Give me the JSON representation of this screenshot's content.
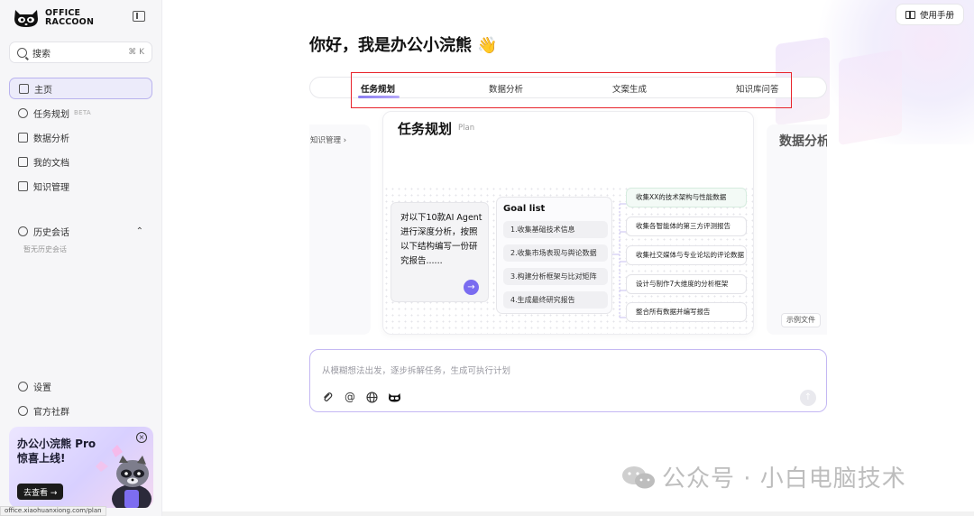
{
  "sidebar": {
    "logo_line1": "OFFICE",
    "logo_line2": "RACCOON",
    "search_label": "搜索",
    "search_shortcut": "⌘ K",
    "nav": [
      {
        "label": "主页",
        "badge": ""
      },
      {
        "label": "任务规划",
        "badge": "BETA"
      },
      {
        "label": "数据分析",
        "badge": ""
      },
      {
        "label": "我的文档",
        "badge": ""
      },
      {
        "label": "知识管理",
        "badge": ""
      }
    ],
    "history_label": "历史会话",
    "history_empty": "暂无历史会话",
    "settings_label": "设置",
    "community_label": "官方社群",
    "promo_title": "办公小浣熊 Pro 惊喜上线!",
    "promo_button": "去查看 →",
    "status_url": "office.xiaohuanxiong.com/plan"
  },
  "header": {
    "manual_label": "使用手册"
  },
  "main": {
    "greeting": "你好，我是办公小浣熊 👋",
    "tabs": [
      "任务规划",
      "数据分析",
      "文案生成",
      "知识库问答"
    ],
    "left_card_label": "知识管理 ›",
    "right_card_title": "数据分析",
    "right_card_button": "示例文件",
    "card": {
      "title": "任务规划",
      "subtitle": "Plan",
      "prompt": "对以下10款AI Agent进行深度分析，按照以下结构编写一份研究报告......",
      "goal_title": "Goal list",
      "goals": [
        "1.收集基础技术信息",
        "2.收集市场表现与舆论数据",
        "3.构建分析框架与比对矩阵",
        "4.生成最终研究报告"
      ],
      "tasks": [
        "收集XX的技术架构与性能数据",
        "收集各智能体的第三方评测报告",
        "收集社交媒体与专业论坛的评论数据",
        "设计与制作7大维度的分析框架",
        "整合所有数据并编写报告"
      ]
    },
    "input_placeholder": "从模糊想法出发，逐步拆解任务，生成可执行计划"
  },
  "watermark": "公众号 · 小白电脑技术",
  "colors": {
    "accent": "#7a6cf0",
    "highlight_box": "#e8232b",
    "sidebar_bg": "#f6f6f8"
  }
}
